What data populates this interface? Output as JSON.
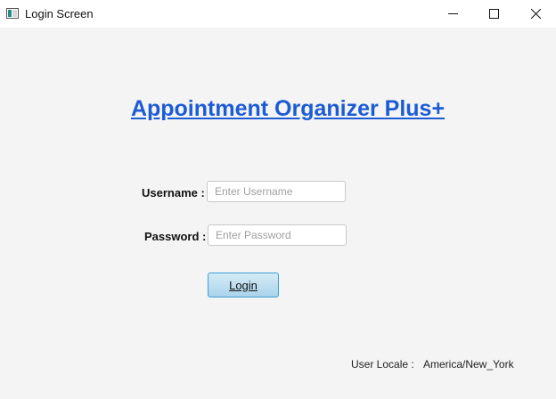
{
  "window": {
    "title": "Login Screen",
    "icons": {
      "app": "app-window-icon",
      "minimize": "minimize-icon",
      "maximize": "maximize-icon",
      "close": "close-icon"
    }
  },
  "heading": "Appointment Organizer Plus+",
  "form": {
    "username_label": "Username :",
    "username_placeholder": "Enter Username",
    "username_value": "",
    "password_label": "Password :",
    "password_placeholder": "Enter Password",
    "password_value": "",
    "login_button": "Login"
  },
  "footer": {
    "locale_label": "User Locale :",
    "locale_value": "America/New_York"
  },
  "colors": {
    "heading": "#1c5bd6",
    "background": "#f4f4f4",
    "button_border": "#3c9fd6"
  }
}
